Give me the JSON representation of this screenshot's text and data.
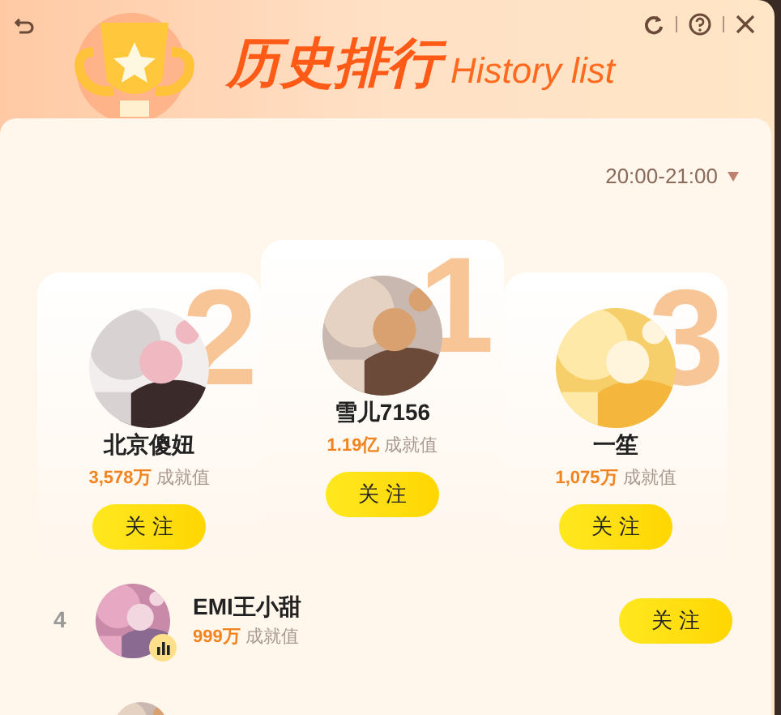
{
  "header": {
    "title": "历史排行",
    "subtitle": "History list"
  },
  "time_range": "20:00-21:00",
  "podium": [
    {
      "rank": "2",
      "name": "北京傻妞",
      "score": "3,578万",
      "unit": "成就值",
      "follow": "关 注"
    },
    {
      "rank": "1",
      "name": "雪儿7156",
      "score": "1.19亿",
      "unit": "成就值",
      "follow": "关 注"
    },
    {
      "rank": "3",
      "name": "一笙",
      "score": "1,075万",
      "unit": "成就值",
      "follow": "关 注"
    }
  ],
  "list": [
    {
      "rank": "4",
      "name": "EMI王小甜",
      "score": "999万",
      "unit": "成就值",
      "follow": "关 注",
      "live": true
    }
  ]
}
